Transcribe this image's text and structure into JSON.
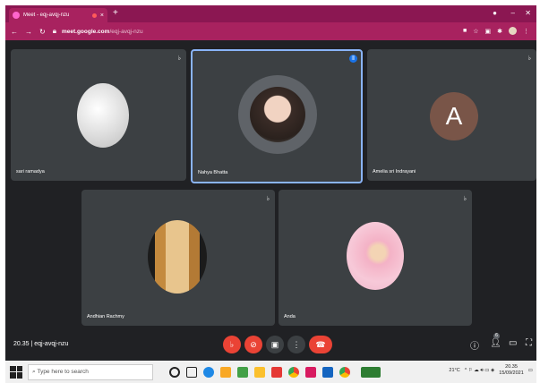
{
  "browser": {
    "tab_title": "Meet - eqj-avqj-nzu",
    "tab_close": "×",
    "new_tab": "+",
    "url_domain": "meet.google.com",
    "url_path": "/eqj-avqj-nzu",
    "min": "–",
    "max": "□",
    "close": "✕"
  },
  "meeting": {
    "time": "20.35",
    "code": "eqj-avqj-nzu",
    "participants": [
      {
        "name": "sari ramadya"
      },
      {
        "name": "Nahya Bhatta"
      },
      {
        "name": "Amelia sri Indrayani",
        "initial": "A"
      },
      {
        "name": "Andhian Rachmy"
      },
      {
        "name": "Anda"
      }
    ],
    "people_count": "6"
  },
  "taskbar": {
    "search_placeholder": "Type here to search",
    "weather": "21°C",
    "time": "20.35",
    "date": "15/09/2021"
  },
  "colors": {
    "tab_bar": "#8b1752",
    "address_bar": "#a8225f",
    "stage": "#202124",
    "tile": "#3c4043",
    "end_call": "#ea4335",
    "active_border": "#8ab4f8"
  }
}
